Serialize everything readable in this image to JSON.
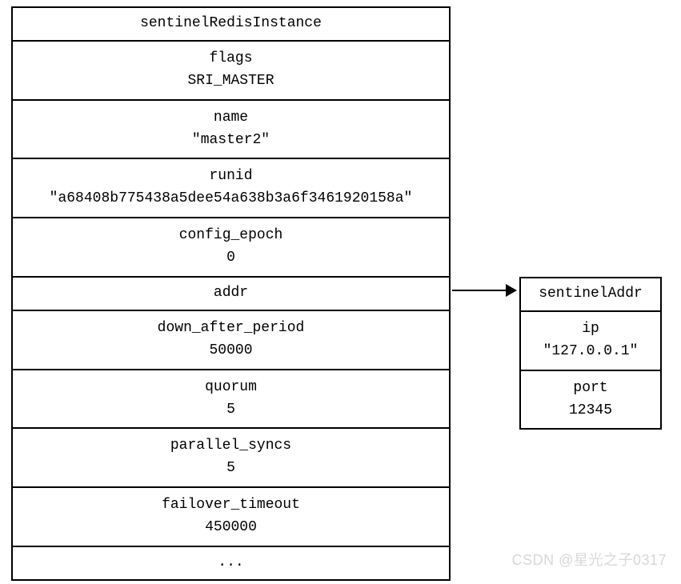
{
  "main": {
    "title": "sentinelRedisInstance",
    "rows": [
      {
        "label": "flags",
        "value": "SRI_MASTER"
      },
      {
        "label": "name",
        "value": "\"master2\""
      },
      {
        "label": "runid",
        "value": "\"a68408b775438a5dee54a638b3a6f3461920158a\""
      },
      {
        "label": "config_epoch",
        "value": "0"
      },
      {
        "label": "addr",
        "value": null
      },
      {
        "label": "down_after_period",
        "value": "50000"
      },
      {
        "label": "quorum",
        "value": "5"
      },
      {
        "label": "parallel_syncs",
        "value": "5"
      },
      {
        "label": "failover_timeout",
        "value": "450000"
      },
      {
        "label": "...",
        "value": null
      }
    ]
  },
  "addr": {
    "title": "sentinelAddr",
    "rows": [
      {
        "label": "ip",
        "value": "\"127.0.0.1\""
      },
      {
        "label": "port",
        "value": "12345"
      }
    ]
  },
  "watermark": "CSDN @星光之子0317"
}
